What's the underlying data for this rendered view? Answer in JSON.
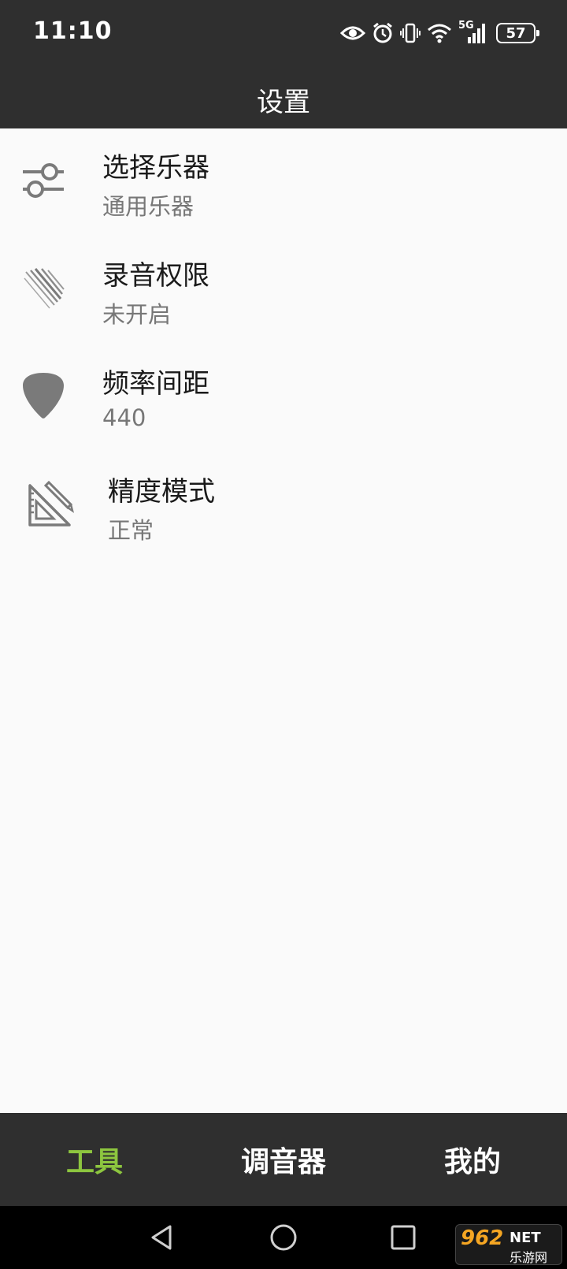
{
  "status_bar": {
    "time": "11:10",
    "network": "5G",
    "battery": "57"
  },
  "header": {
    "title": "设置"
  },
  "settings": [
    {
      "title": "选择乐器",
      "value": "通用乐器",
      "icon": "sliders-icon"
    },
    {
      "title": "录音权限",
      "value": "未开启",
      "icon": "diagonal-lines-icon"
    },
    {
      "title": "频率间距",
      "value": "440",
      "icon": "guitar-pick-icon"
    },
    {
      "title": "精度模式",
      "value": "正常",
      "icon": "set-square-ruler-icon"
    }
  ],
  "bottom_nav": {
    "tabs": [
      {
        "label": "工具",
        "active": true
      },
      {
        "label": "调音器",
        "active": false
      },
      {
        "label": "我的",
        "active": false
      }
    ]
  },
  "watermark": {
    "logo": "962",
    "net": "NET",
    "sub": "乐游网"
  },
  "colors": {
    "bar_background": "#2f2f2f",
    "active_tab": "#8dc63f",
    "icon_gray": "#7a7a7a",
    "content_background": "#fafafa"
  }
}
